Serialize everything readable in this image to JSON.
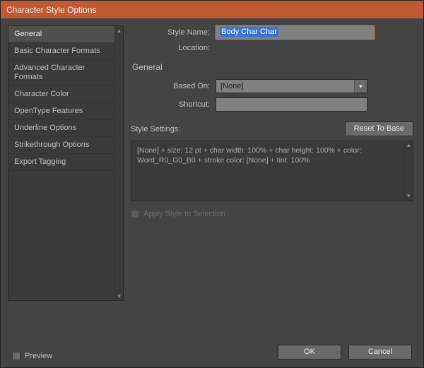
{
  "window": {
    "title": "Character Style Options"
  },
  "sidebar": {
    "items": [
      {
        "label": "General",
        "active": true
      },
      {
        "label": "Basic Character Formats",
        "active": false
      },
      {
        "label": "Advanced Character Formats",
        "active": false
      },
      {
        "label": "Character Color",
        "active": false
      },
      {
        "label": "OpenType Features",
        "active": false
      },
      {
        "label": "Underline Options",
        "active": false
      },
      {
        "label": "Strikethrough Options",
        "active": false
      },
      {
        "label": "Export Tagging",
        "active": false
      }
    ]
  },
  "form": {
    "style_name_label": "Style Name:",
    "style_name_value": "Body Char Char",
    "location_label": "Location:",
    "location_value": ""
  },
  "general": {
    "heading": "General",
    "based_on_label": "Based On:",
    "based_on_value": "[None]",
    "shortcut_label": "Shortcut:",
    "shortcut_value": ""
  },
  "settings": {
    "label": "Style Settings:",
    "reset_label": "Reset To Base",
    "text": "[None] + size: 12 pt + char width: 100% + char height: 100% + color: Word_R0_G0_B0 + stroke color: [None] + tint: 100%"
  },
  "apply_checkbox": {
    "label": "Apply Style to Selection"
  },
  "footer": {
    "preview_label": "Preview",
    "ok_label": "OK",
    "cancel_label": "Cancel"
  }
}
